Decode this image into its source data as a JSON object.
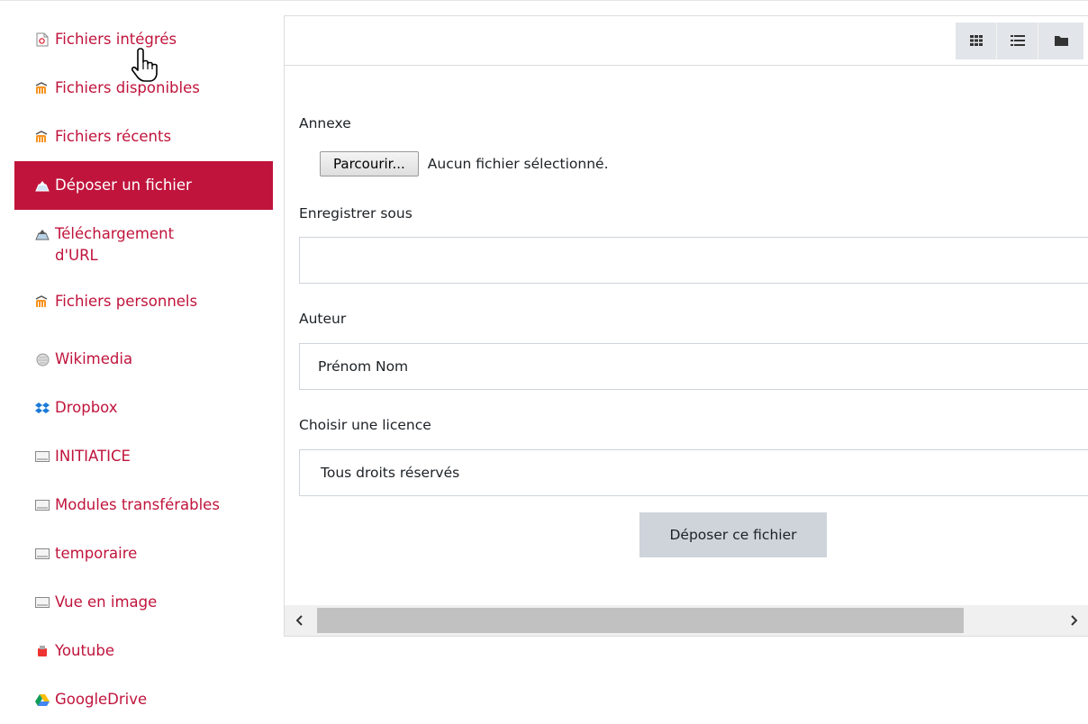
{
  "sidebar": {
    "items": [
      {
        "label": "Fichiers intégrés",
        "icon": "file-icon"
      },
      {
        "label": "Fichiers disponibles",
        "icon": "moodle-icon"
      },
      {
        "label": "Fichiers récents",
        "icon": "moodle-icon"
      },
      {
        "label": "Déposer un fichier",
        "icon": "upload-icon",
        "active": true
      },
      {
        "label": "Téléchargement d'URL",
        "icon": "url-download-icon"
      },
      {
        "label": "Fichiers personnels",
        "icon": "moodle-icon"
      },
      {
        "label": "Wikimedia",
        "icon": "wikimedia-icon"
      },
      {
        "label": "Dropbox",
        "icon": "dropbox-icon"
      },
      {
        "label": "INITIATICE",
        "icon": "repository-icon"
      },
      {
        "label": "Modules transférables",
        "icon": "repository-icon"
      },
      {
        "label": "temporaire",
        "icon": "repository-icon"
      },
      {
        "label": "Vue en image",
        "icon": "repository-icon"
      },
      {
        "label": "Youtube",
        "icon": "youtube-icon"
      },
      {
        "label": "GoogleDrive",
        "icon": "google-drive-icon"
      }
    ]
  },
  "form": {
    "attachment_label": "Annexe",
    "browse_label": "Parcourir...",
    "no_file_text": "Aucun fichier sélectionné.",
    "save_as_label": "Enregistrer sous",
    "save_as_value": "",
    "author_label": "Auteur",
    "author_value": "Prénom Nom",
    "license_label": "Choisir une licence",
    "license_value": "Tous droits réservés",
    "submit_label": "Déposer ce fichier"
  },
  "colors": {
    "accent": "#c0143c",
    "button_gray": "#ced4da"
  }
}
